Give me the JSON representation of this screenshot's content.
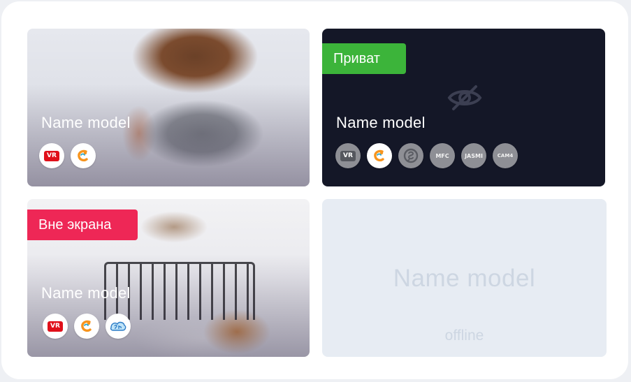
{
  "cards": [
    {
      "name": "Name model",
      "platforms": [
        "vr-icon",
        "chaturbate-icon"
      ],
      "vr_label": "VR"
    },
    {
      "badge": "Приват",
      "name": "Name model",
      "platforms": [
        "vr-icon",
        "chaturbate-icon",
        "stripchat-icon",
        "mfc-icon",
        "jasmin-icon",
        "cam4-icon"
      ],
      "vr_label": "VR",
      "mfc_label": "MFC",
      "jasmin_label": "JASMI",
      "cam4_label": "CAM4",
      "hidden_icon": "eye-off-icon",
      "colors": {
        "card_bg": "#141727",
        "badge_bg": "#3cb43a"
      }
    },
    {
      "badge": "Вне экрана",
      "name": "Name model",
      "platforms": [
        "vr-icon",
        "chaturbate-icon",
        "bongacams-icon"
      ],
      "vr_label": "VR",
      "colors": {
        "badge_bg": "#ee2756"
      }
    },
    {
      "name": "Name model",
      "status": "offline",
      "colors": {
        "card_bg": "#e7ecf3",
        "text": "#cdd6e2"
      }
    }
  ]
}
